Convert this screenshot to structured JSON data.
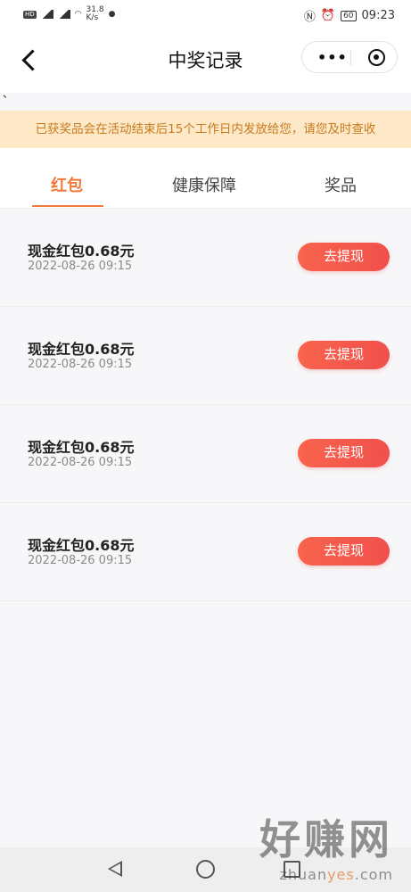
{
  "status_bar": {
    "speed": "31.8\nK/s",
    "battery": "60",
    "time": "09:23"
  },
  "nav": {
    "title": "中奖记录",
    "more_glyph": "•••"
  },
  "stray_mark": "、",
  "notice": "已获奖品会在活动结束后15个工作日内发放给您，请您及时查收",
  "tabs": [
    {
      "label": "红包",
      "active": true
    },
    {
      "label": "健康保障",
      "active": false
    },
    {
      "label": "奖品",
      "active": false
    }
  ],
  "records": [
    {
      "title": "现金红包0.68元",
      "time": "2022-08-26 09:15",
      "button": "去提现"
    },
    {
      "title": "现金红包0.68元",
      "time": "2022-08-26 09:15",
      "button": "去提现"
    },
    {
      "title": "现金红包0.68元",
      "time": "2022-08-26 09:15",
      "button": "去提现"
    },
    {
      "title": "现金红包0.68元",
      "time": "2022-08-26 09:15",
      "button": "去提现"
    }
  ],
  "watermark": {
    "main": "好赚网",
    "sub_a": "zhuan",
    "sub_b": "yes",
    "sub_c": ".com"
  },
  "colors": {
    "accent": "#ef7a3b",
    "button": "#f0504c",
    "notice_bg": "#fde9c8",
    "notice_text": "#c97a1d"
  }
}
